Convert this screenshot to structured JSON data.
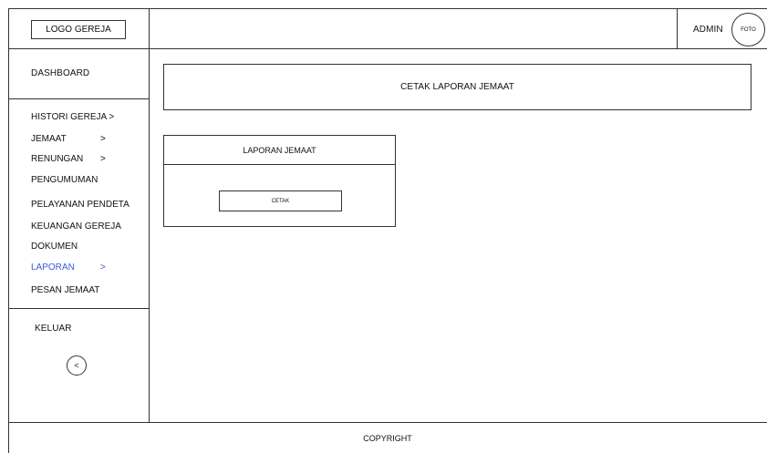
{
  "header": {
    "logo_label": "LOGO GEREJA",
    "user_label": "ADMIN",
    "avatar_label": "FOTO"
  },
  "sidebar": {
    "dashboard": "DASHBOARD",
    "items": [
      {
        "label": "HISTORI GEREJA  >"
      },
      {
        "label": "JEMAAT",
        "chevron": ">"
      },
      {
        "label": "RENUNGAN",
        "chevron": ">"
      },
      {
        "label": "PENGUMUMAN"
      },
      {
        "label": "PELAYANAN PENDETA"
      },
      {
        "label": "KEUANGAN GEREJA"
      },
      {
        "label": "DOKUMEN"
      },
      {
        "label": "LAPORAN",
        "chevron": ">"
      },
      {
        "label": "PESAN JEMAAT"
      }
    ],
    "logout": "KELUAR",
    "back_icon": "<"
  },
  "main": {
    "title": "CETAK LAPORAN JEMAAT",
    "panel": {
      "title": "LAPORAN JEMAAT",
      "button_label": "CETAK"
    }
  },
  "footer": {
    "text": "COPYRIGHT"
  },
  "colors": {
    "border": "#333333",
    "active_nav": "#3b5bd6"
  }
}
